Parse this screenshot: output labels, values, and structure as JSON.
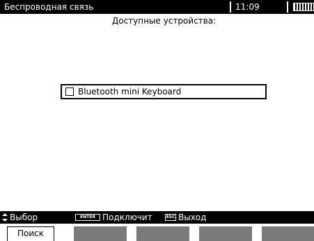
{
  "header": {
    "title": "Беспроводная связь",
    "time": "11:09"
  },
  "main": {
    "heading": "Доступные устройства:",
    "devices": [
      {
        "label": "Bluetooth mini Keyboard",
        "checked": false
      }
    ]
  },
  "statusbar": {
    "select_label": "Выбор",
    "enter_key": "ENTER",
    "connect_label": "Подключит",
    "esc_key": "ESC",
    "exit_label": "Выход"
  },
  "softkeys": {
    "search_label": "Поиск"
  },
  "icons": {
    "updown": "up-down-arrow-icon",
    "battery": "battery-icon",
    "checkbox": "checkbox-icon"
  },
  "colors": {
    "bar": "#000000",
    "background": "#ffffff",
    "softkey_inactive": "#7a7a7a"
  }
}
